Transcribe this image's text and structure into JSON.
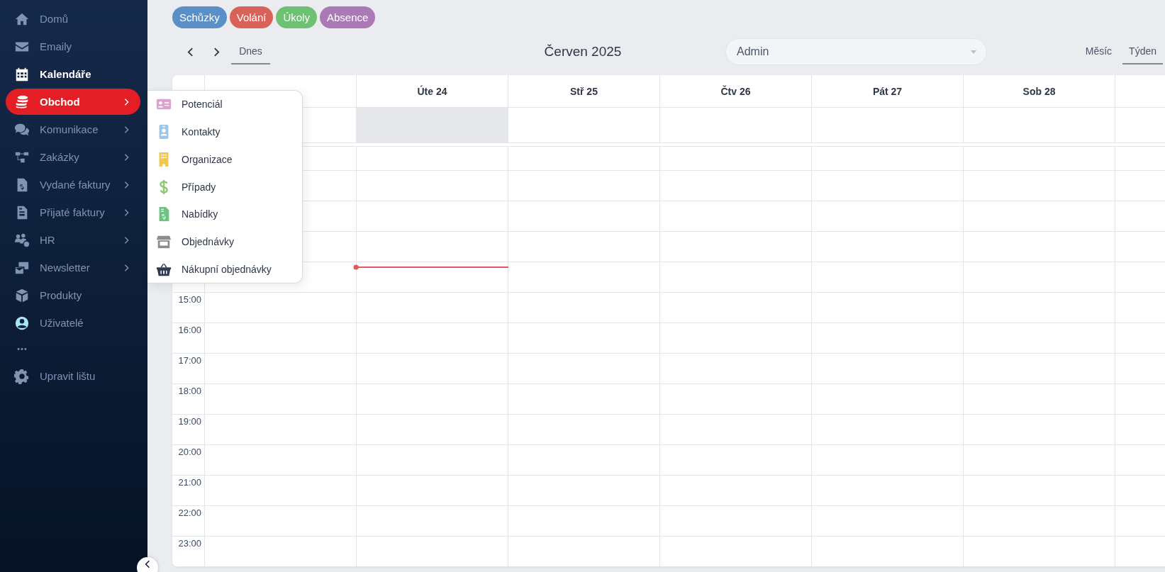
{
  "sidebar": {
    "items": [
      {
        "label": "Domů",
        "selected": false,
        "current": false,
        "submenu": false
      },
      {
        "label": "Emaily",
        "selected": false,
        "current": false,
        "submenu": false
      },
      {
        "label": "Kalendáře",
        "selected": false,
        "current": true,
        "submenu": false
      },
      {
        "label": "Obchod",
        "selected": true,
        "current": false,
        "submenu": true
      },
      {
        "label": "Komunikace",
        "selected": false,
        "current": false,
        "submenu": true
      },
      {
        "label": "Zakázky",
        "selected": false,
        "current": false,
        "submenu": true
      },
      {
        "label": "Vydané faktury",
        "selected": false,
        "current": false,
        "submenu": true
      },
      {
        "label": "Přijaté faktury",
        "selected": false,
        "current": false,
        "submenu": true
      },
      {
        "label": "HR",
        "selected": false,
        "current": false,
        "submenu": true
      },
      {
        "label": "Newsletter",
        "selected": false,
        "current": false,
        "submenu": true
      },
      {
        "label": "Produkty",
        "selected": false,
        "current": false,
        "submenu": false
      },
      {
        "label": "Uživatelé",
        "selected": false,
        "current": false,
        "submenu": false
      }
    ],
    "settings": {
      "label": "Upravit lištu"
    }
  },
  "submenu": {
    "items": [
      {
        "label": "Potenciál"
      },
      {
        "label": "Kontakty"
      },
      {
        "label": "Organizace"
      },
      {
        "label": "Případy"
      },
      {
        "label": "Nabídky"
      },
      {
        "label": "Objednávky"
      },
      {
        "label": "Nákupní objednávky"
      }
    ]
  },
  "filters": [
    {
      "label": "Schůzky",
      "color": "#5b8fc7"
    },
    {
      "label": "Volání",
      "color": "#d8625a"
    },
    {
      "label": "Úkoly",
      "color": "#6cc172"
    },
    {
      "label": "Absence",
      "color": "#ab7ab4"
    }
  ],
  "toolbar": {
    "today": "Dnes",
    "title": "Červen 2025",
    "user_select": {
      "value": "Admin"
    },
    "views": [
      {
        "label": "Měsíc",
        "selected": false
      },
      {
        "label": "Týden",
        "selected": true
      }
    ]
  },
  "calendar": {
    "days": [
      {
        "today": false
      },
      {
        "label": "Úte 24",
        "today": true
      },
      {
        "label": "Stř 25",
        "today": false
      },
      {
        "label": "Čtv 26",
        "today": false
      },
      {
        "label": "Pát 27",
        "today": false
      },
      {
        "label": "Sob 28",
        "today": false
      }
    ],
    "hours": [
      "15:00",
      "16:00",
      "17:00",
      "18:00",
      "19:00",
      "20:00",
      "21:00",
      "22:00",
      "23:00"
    ]
  }
}
